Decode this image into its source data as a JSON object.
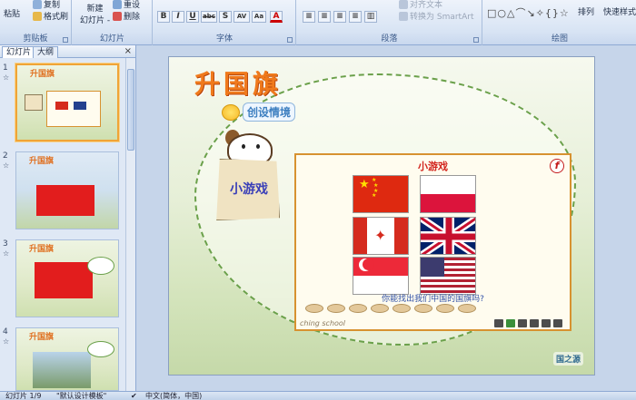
{
  "ribbon": {
    "clipboard": {
      "label": "剪贴板",
      "paste": "粘贴",
      "copy": "复制",
      "format_painter": "格式刷"
    },
    "slides": {
      "label": "幻灯片",
      "new_slide": "新建\n幻灯片",
      "new_slide_line1": "新建",
      "new_slide_line2": "幻灯片 -",
      "reset": "重设",
      "delete": "删除"
    },
    "font": {
      "label": "字体",
      "bold": "B",
      "italic": "I",
      "underline": "U",
      "strike": "abc",
      "shadow": "S",
      "spacing": "AV",
      "case": "Aa",
      "color": "A"
    },
    "paragraph": {
      "label": "段落",
      "text_direction": "对齐文本",
      "smartart": "转换为 SmartArt"
    },
    "drawing": {
      "label": "绘图",
      "arrange": "排列",
      "quick_styles": "快速样式"
    }
  },
  "pane": {
    "tab_slides": "幻灯片",
    "tab_outline": "大纲",
    "close": "×",
    "thumbnails": [
      {
        "num": "1",
        "title": "升国旗",
        "selected": true
      },
      {
        "num": "2",
        "title": "升国旗",
        "selected": false
      },
      {
        "num": "3",
        "title": "升国旗",
        "selected": false
      },
      {
        "num": "4",
        "title": "升国旗",
        "selected": false
      }
    ]
  },
  "slide": {
    "title": "升国旗",
    "subtitle": "创设情境",
    "bag_label": "小游戏",
    "game": {
      "title": "小游戏",
      "flash": "f",
      "question": "你能找出我们中国的国旗吗?",
      "brand": "ching school",
      "flags": [
        "china",
        "poland",
        "canada",
        "united-kingdom",
        "singapore",
        "united-states"
      ]
    },
    "logo": "国之源"
  },
  "status": {
    "slide_count": "幻灯片 1/9",
    "theme": "\"默认设计模板\"",
    "language": "中文(简体，中国)"
  },
  "colors": {
    "accent_orange": "#f07a1c",
    "ribbon": "#d8e4f4",
    "selection": "#f0a436"
  }
}
